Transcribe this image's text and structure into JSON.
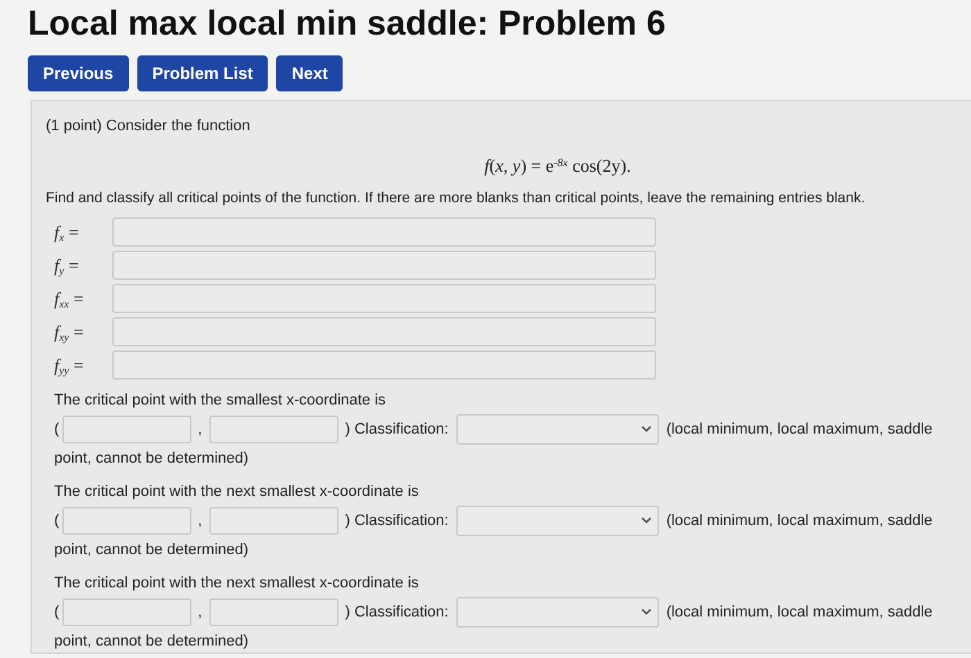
{
  "title": "Local max local min saddle: Problem 6",
  "nav_buttons": [
    "Previous",
    "Problem List",
    "Next"
  ],
  "problem": {
    "intro": "(1 point) Consider the function",
    "formula": "*f*(*x*, *y*) = e$^{-8x}$ cos(2y).",
    "instructions": "Find and classify all critical points of the function. If there are more blanks than critical points, leave the remaining entries blank.",
    "derivatives": [
      {
        "label": "*f*$_{x}$ ="
      },
      {
        "label": "*f*$_{y}$ ="
      },
      {
        "label": "*f*$_{xx}$ ="
      },
      {
        "label": "*f*$_{xy}$ ="
      },
      {
        "label": "*f*$_{yy}$ ="
      }
    ],
    "critical_points": [
      {
        "prompt": "The critical point with the smallest x-coordinate is",
        "open": "(",
        "comma": ",",
        "close": ") Classification:",
        "hint_line_1": "(local minimum, local maximum, saddle",
        "hint_line_2": "point, cannot be determined)"
      },
      {
        "prompt": "The critical point with the next smallest x-coordinate is",
        "open": "(",
        "comma": ",",
        "close": ") Classification:",
        "hint_line_1": "(local minimum, local maximum, saddle",
        "hint_line_2": "point, cannot be determined)"
      },
      {
        "prompt": "The critical point with the next smallest x-coordinate is",
        "open": "(",
        "comma": ",",
        "close": ") Classification:",
        "hint_line_1": "(local minimum, local maximum, saddle",
        "hint_line_2": "point, cannot be determined)"
      }
    ]
  }
}
